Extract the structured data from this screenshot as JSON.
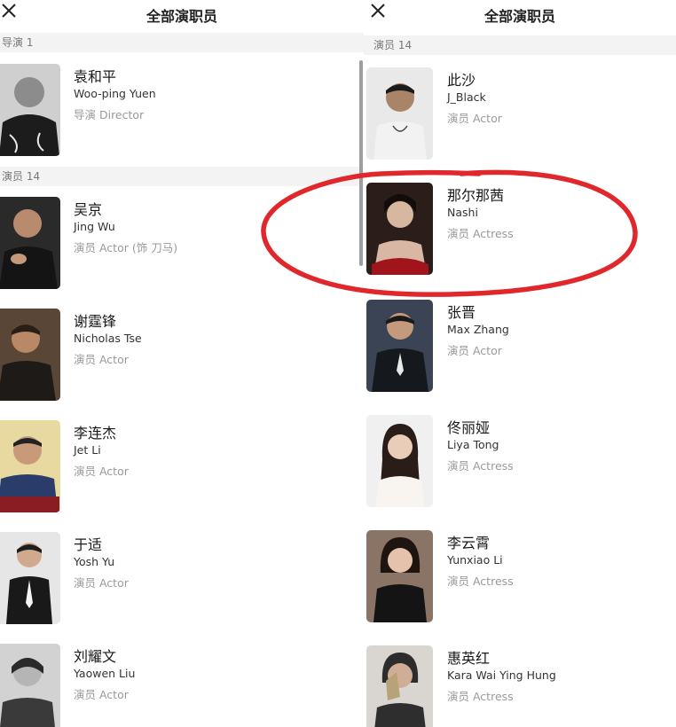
{
  "left": {
    "title": "全部演职员",
    "director_section": "导演 1",
    "actor_section": "演员 14",
    "directors": [
      {
        "name": "袁和平",
        "en": "Woo-ping Yuen",
        "role": "导演 Director"
      }
    ],
    "actors": [
      {
        "name": "吴京",
        "en": "Jing Wu",
        "role": "演员 Actor (饰 刀马)"
      },
      {
        "name": "谢霆锋",
        "en": "Nicholas Tse",
        "role": "演员 Actor"
      },
      {
        "name": "李连杰",
        "en": "Jet Li",
        "role": "演员 Actor"
      },
      {
        "name": "于适",
        "en": "Yosh Yu",
        "role": "演员 Actor"
      },
      {
        "name": "刘耀文",
        "en": "Yaowen Liu",
        "role": "演员 Actor"
      }
    ]
  },
  "right": {
    "title": "全部演职员",
    "actor_section": "演员 14",
    "actors": [
      {
        "name": "此沙",
        "en": "J_Black",
        "role": "演员 Actor"
      },
      {
        "name": "那尔那茜",
        "en": "Nashi",
        "role": "演员 Actress"
      },
      {
        "name": "张晋",
        "en": "Max Zhang",
        "role": "演员 Actor"
      },
      {
        "name": "佟丽娅",
        "en": "Liya Tong",
        "role": "演员 Actress"
      },
      {
        "name": "李云霄",
        "en": "Yunxiao Li",
        "role": "演员 Actress"
      },
      {
        "name": "惠英红",
        "en": "Kara Wai Ying Hung",
        "role": "演员 Actress"
      }
    ]
  },
  "colors": {
    "annotation_circle": "#e0272b",
    "section_bg": "#f3f3f3",
    "role_text": "#9a9a9a"
  },
  "icons": {
    "close": "close-icon"
  }
}
